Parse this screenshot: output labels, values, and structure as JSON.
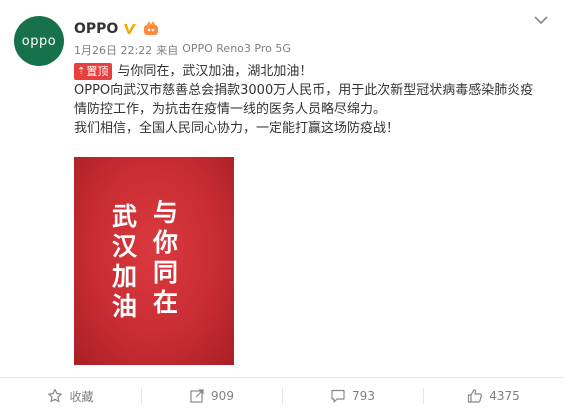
{
  "post": {
    "username": "OPPO",
    "avatar_text": "oppo",
    "date": "1月26日 22:22",
    "source_prefix": "来自",
    "source_device": "OPPO Reno3 Pro 5G",
    "top_badge": "置顶",
    "lines": [
      "与你同在，武汉加油，湖北加油！",
      "OPPO向武汉市慈善总会捐款3000万人民币，用于此次新型冠状病毒感染肺炎疫",
      "情防控工作，为抗击在疫情一线的医务人员略尽绵力。",
      "我们相信，全国人民同心协力，一定能打赢这场防疫战！"
    ],
    "poster": {
      "right_column": [
        "与",
        "你",
        "同",
        "在"
      ],
      "left_column": [
        "武",
        "汉",
        "加",
        "油"
      ]
    }
  },
  "actions": {
    "favorite_label": "收藏",
    "repost_count": "909",
    "comment_count": "793",
    "like_count": "4375"
  },
  "colors": {
    "brand_green": "#17714a",
    "poster_red": "#c92c33",
    "badge_red": "#e8403f",
    "verified_orange": "#f7a800"
  },
  "icons": [
    "more-chevron-icon",
    "verified-icon",
    "member-icon",
    "pin-icon",
    "star-icon",
    "repost-icon",
    "comment-icon",
    "like-icon"
  ]
}
